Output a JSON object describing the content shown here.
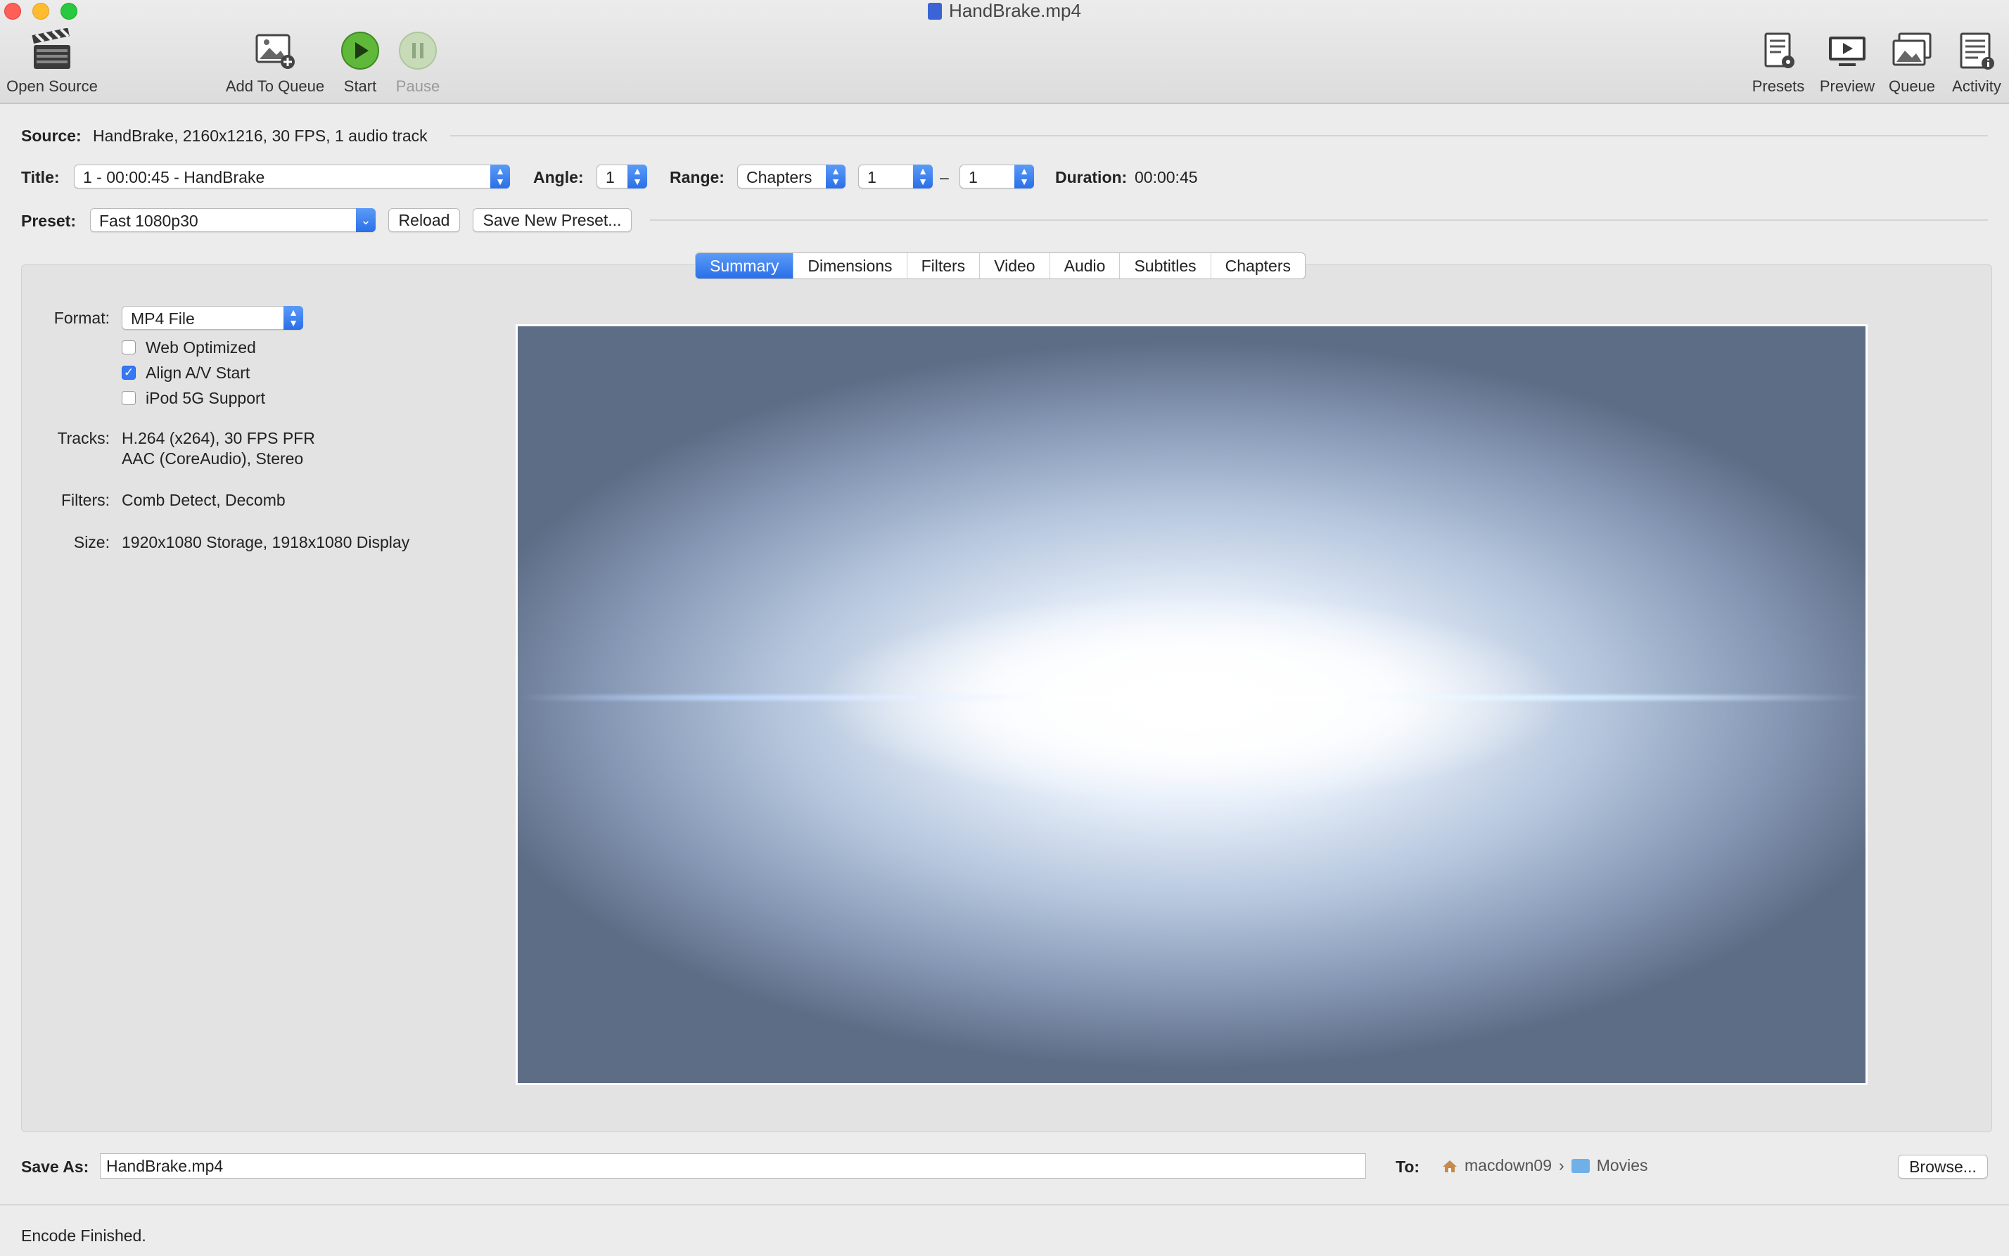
{
  "window": {
    "title": "HandBrake.mp4"
  },
  "toolbar": {
    "open_source": "Open Source",
    "add_to_queue": "Add To Queue",
    "start": "Start",
    "pause": "Pause",
    "presets": "Presets",
    "preview": "Preview",
    "queue": "Queue",
    "activity": "Activity"
  },
  "source": {
    "label": "Source:",
    "value": "HandBrake, 2160x1216, 30 FPS, 1 audio track"
  },
  "title_row": {
    "title_label": "Title:",
    "title_value": "1 - 00:00:45 - HandBrake",
    "angle_label": "Angle:",
    "angle_value": "1",
    "range_label": "Range:",
    "range_value": "Chapters",
    "range_start": "1",
    "range_dash": "–",
    "range_end": "1",
    "duration_label": "Duration:",
    "duration_value": "00:00:45"
  },
  "preset_row": {
    "label": "Preset:",
    "value": "Fast 1080p30",
    "reload": "Reload",
    "save_new": "Save New Preset..."
  },
  "tabs": [
    "Summary",
    "Dimensions",
    "Filters",
    "Video",
    "Audio",
    "Subtitles",
    "Chapters"
  ],
  "active_tab": "Summary",
  "summary": {
    "format_label": "Format:",
    "format_value": "MP4 File",
    "options": [
      {
        "label": "Web Optimized",
        "checked": false
      },
      {
        "label": "Align A/V Start",
        "checked": true
      },
      {
        "label": "iPod 5G Support",
        "checked": false
      }
    ],
    "tracks_label": "Tracks:",
    "tracks_line1": "H.264 (x264), 30 FPS PFR",
    "tracks_line2": "AAC (CoreAudio), Stereo",
    "filters_label": "Filters:",
    "filters_value": "Comb Detect, Decomb",
    "size_label": "Size:",
    "size_value": "1920x1080 Storage, 1918x1080 Display"
  },
  "destination": {
    "save_as_label": "Save As:",
    "save_as_value": "HandBrake.mp4",
    "to_label": "To:",
    "path_user": "macdown09",
    "path_folder": "Movies",
    "browse": "Browse..."
  },
  "status": {
    "text": "Encode Finished."
  },
  "colors": {
    "accent": "#3478f6",
    "start_green": "#5fb83a"
  }
}
